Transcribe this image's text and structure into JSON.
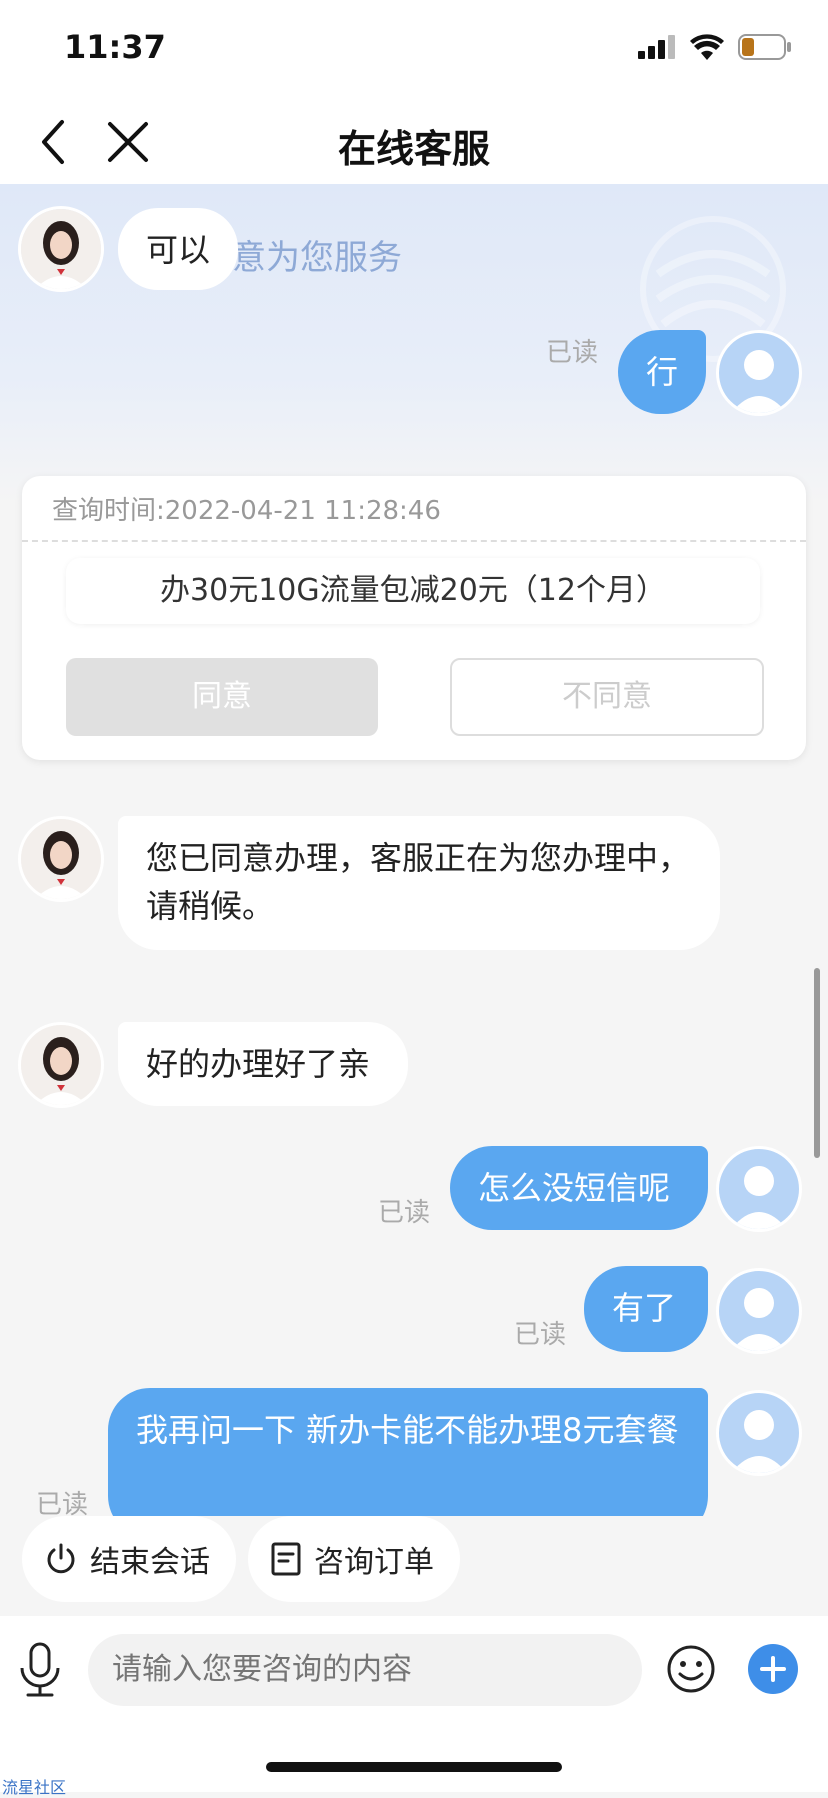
{
  "status_bar": {
    "time": "11:37"
  },
  "nav": {
    "title": "在线客服"
  },
  "banner": {
    "text": "意为您服务"
  },
  "messages": {
    "m1_agent": "可以",
    "m2_user": "行",
    "m2_read": "已读",
    "card": {
      "query_time": "查询时间:2022-04-21 11:28:46",
      "offer": "办30元10G流量包减20元（12个月）",
      "agree": "同意",
      "disagree": "不同意"
    },
    "m3_agent": "您已同意办理，客服正在为您办理中，请稍候。",
    "m4_agent": "好的办理好了亲",
    "m5_user": "怎么没短信呢",
    "m5_read": "已读",
    "m6_user": "有了",
    "m6_read": "已读",
    "m7_user": "我再问一下 新办卡能不能办理8元套餐",
    "m7_read": "已读"
  },
  "quick_actions": {
    "end": "结束会话",
    "order": "咨询订单"
  },
  "input": {
    "placeholder": "请输入您要咨询的内容"
  },
  "watermark": "流星社区",
  "colors": {
    "user_bubble": "#5aa7f0",
    "accent": "#3e8ee8"
  }
}
